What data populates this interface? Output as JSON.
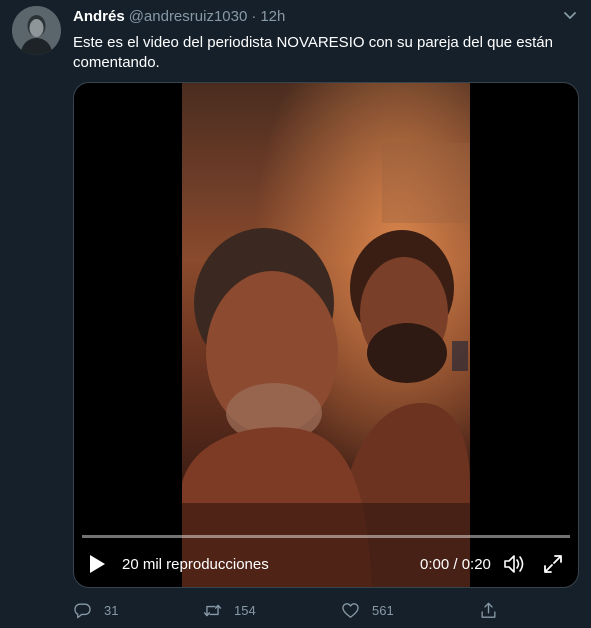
{
  "tweet": {
    "author_name": "Andrés",
    "author_handle": "@andresruiz1030",
    "separator": "·",
    "time": "12h",
    "text": "Este es el video del periodista NOVARESIO con su pareja del que están comentando."
  },
  "video": {
    "views": "20 mil reproducciones",
    "time_readout": "0:00 / 0:20",
    "progress": 0
  },
  "actions": {
    "replies": "31",
    "retweets": "154",
    "likes": "561"
  },
  "icons": {
    "menu": "chevron-down-icon",
    "play": "play-icon",
    "volume": "volume-muted-icon",
    "fullscreen": "fullscreen-icon",
    "reply": "reply-icon",
    "retweet": "retweet-icon",
    "like": "heart-icon",
    "share": "share-icon"
  },
  "colors": {
    "background": "#15202b",
    "secondary_text": "#8899a6",
    "border": "#38444d"
  }
}
